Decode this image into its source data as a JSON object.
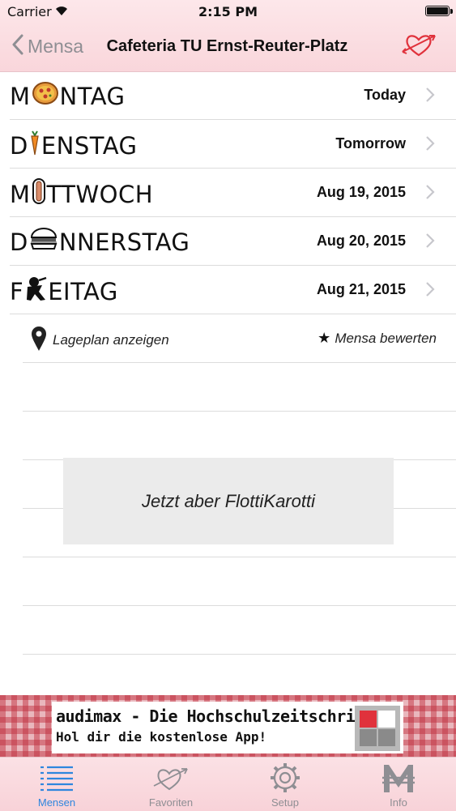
{
  "status_bar": {
    "carrier": "Carrier",
    "time": "2:15 PM"
  },
  "nav": {
    "back_label": "Mensa",
    "title": "Cafeteria TU Ernst-Reuter-Platz"
  },
  "days": [
    {
      "initial": "M",
      "rest": "NTAG",
      "icon": "pizza-icon",
      "date": "Today"
    },
    {
      "initial": "D",
      "rest": "ENSTAG",
      "icon": "carrot-icon",
      "date": "Tomorrow"
    },
    {
      "initial": "M",
      "rest": "TTWOCH",
      "icon": "hotdog-icon",
      "date": "Aug 19, 2015"
    },
    {
      "initial": "D",
      "rest": "NNERSTAG",
      "icon": "burger-icon",
      "date": "Aug 20, 2015"
    },
    {
      "initial": "F",
      "rest": "EITAG",
      "icon": "cook-icon",
      "date": "Aug 21, 2015"
    }
  ],
  "actions": {
    "map_label": "Lageplan anzeigen",
    "rate_star": "★",
    "rate_label": "Mensa bewerten"
  },
  "promo": {
    "text": "Jetzt aber FlottiKarotti"
  },
  "ad": {
    "title": "audimax - Die Hochschulzeitschrift",
    "subtitle": "Hol dir die kostenlose App!"
  },
  "tabs": [
    {
      "label": "Mensen",
      "icon": "list-icon",
      "active": true
    },
    {
      "label": "Favoriten",
      "icon": "heart-arrow-icon",
      "active": false
    },
    {
      "label": "Setup",
      "icon": "gear-icon",
      "active": false
    },
    {
      "label": "Info",
      "icon": "mensa-m-icon",
      "active": false
    }
  ],
  "colors": {
    "tint": "#e0323c",
    "tab_active": "#2e86de",
    "bar_bg": "#fbe1e5"
  }
}
